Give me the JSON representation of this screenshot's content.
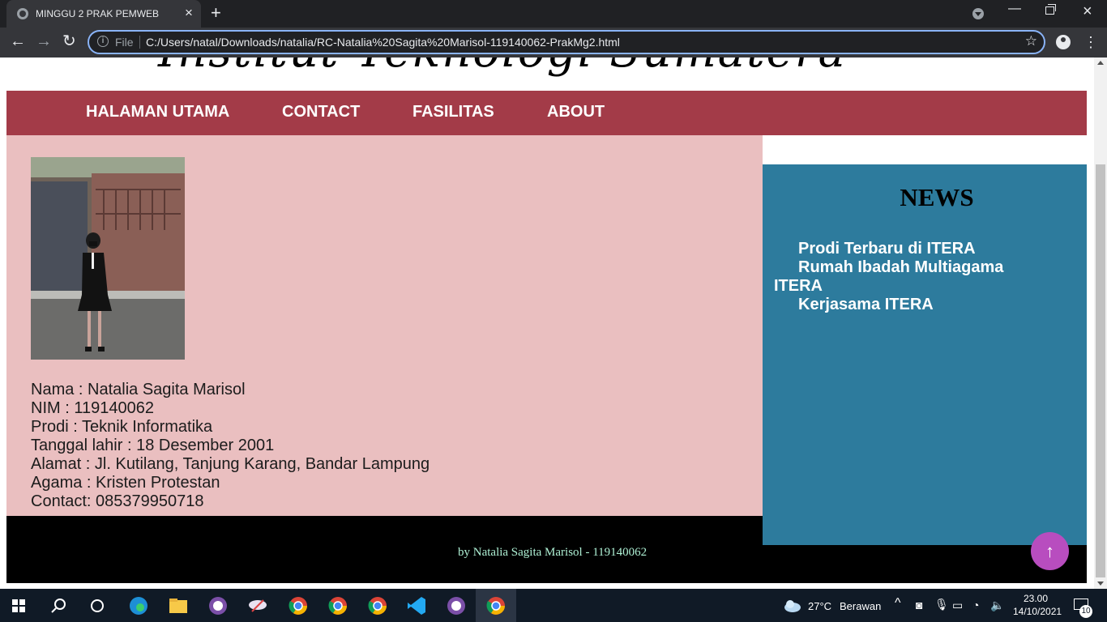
{
  "browser": {
    "tab_title": "MINGGU 2 PRAK PEMWEB",
    "file_label": "File",
    "url": "C:/Users/natal/Downloads/natalia/RC-Natalia%20Sagita%20Marisol-119140062-PrakMg2.html"
  },
  "page": {
    "banner_title": "Institut Teknologi Sumatera",
    "nav": [
      "HALAMAN UTAMA",
      "CONTACT",
      "FASILITAS",
      "ABOUT"
    ],
    "profile_photo": "profile-photo",
    "bio": [
      "Nama : Natalia Sagita Marisol",
      "NIM : 119140062",
      "Prodi : Teknik Informatika",
      "Tanggal lahir : 18 Desember 2001",
      "Alamat : Jl. Kutilang, Tanjung Karang, Bandar Lampung",
      "Agama : Kristen Protestan",
      "Contact: 085379950718"
    ],
    "news": {
      "heading": "NEWS",
      "items": [
        "Prodi Terbaru di ITERA",
        "Rumah Ibadah Multiagama ITERA",
        "Kerjasama ITERA"
      ]
    },
    "footer": "by Natalia Sagita Marisol - 119140062",
    "back_to_top": "↑",
    "colors": {
      "navbar": "#a33b48",
      "content": "#eabfc0",
      "sidebar": "#2d7b9d",
      "footer": "#000000",
      "footer_text": "#aef0d4",
      "back_to_top": "#b84dbf"
    }
  },
  "taskbar": {
    "weather_temp": "27°C",
    "weather_desc": "Berawan",
    "time": "23.00",
    "date": "14/10/2021",
    "notification_count": "10"
  }
}
